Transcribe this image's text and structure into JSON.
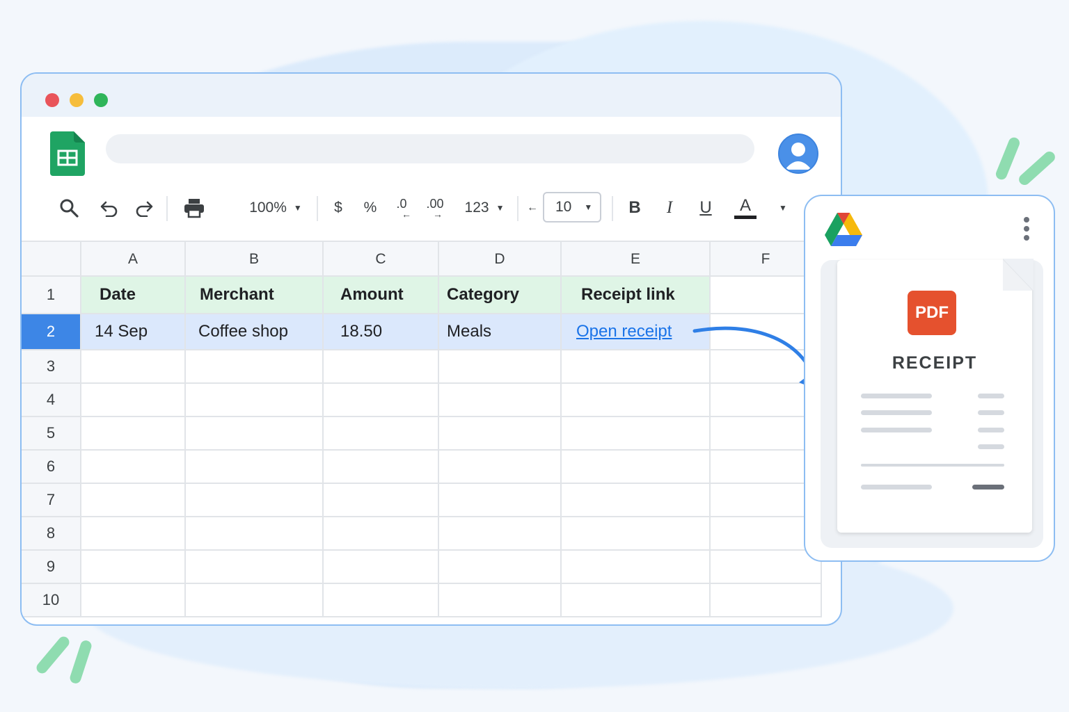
{
  "toolbar": {
    "zoom": "100%",
    "currency": "$",
    "percent": "%",
    "decrease_decimal": ".0",
    "increase_decimal": ".00",
    "number_format": "123",
    "font_size": "10",
    "bold": "B",
    "italic": "I",
    "underline": "U",
    "text_color": "A"
  },
  "columns": [
    "A",
    "B",
    "C",
    "D",
    "E",
    "F"
  ],
  "row_numbers": [
    "1",
    "2",
    "3",
    "4",
    "5",
    "6",
    "7",
    "8",
    "9",
    "10"
  ],
  "sheet": {
    "header": {
      "date": "Date",
      "merchant": "Merchant",
      "amount": "Amount",
      "category": "Category",
      "receipt": "Receipt link"
    },
    "row2": {
      "date": "14 Sep",
      "merchant": "Coffee shop",
      "amount": "18.50",
      "category": "Meals",
      "receipt": "Open receipt"
    }
  },
  "drive": {
    "file_type": "PDF",
    "file_title": "RECEIPT"
  },
  "colors": {
    "sheets_green": "#1fa463",
    "accent_blue": "#1a73e8",
    "header_fill": "#dff5e6",
    "selected_row_fill": "#dbe8fc",
    "pdf_red": "#e5512e"
  },
  "icons": [
    "search-icon",
    "undo-icon",
    "redo-icon",
    "print-icon",
    "sheets-logo",
    "user-avatar-icon",
    "google-drive-logo",
    "more-vert-icon",
    "pdf-icon"
  ]
}
